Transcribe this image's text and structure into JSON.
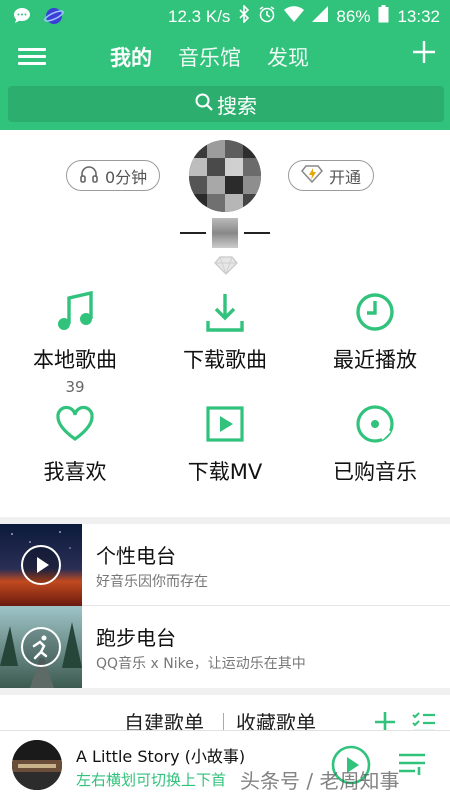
{
  "status_bar": {
    "speed": "12.3 K/s",
    "battery": "86%",
    "time": "13:32"
  },
  "header": {
    "tabs": [
      "我的",
      "音乐馆",
      "发现"
    ],
    "active_tab": "我的",
    "search_label": "搜索"
  },
  "profile": {
    "listen_time": "0分钟",
    "open_vip_label": "开通"
  },
  "grid": {
    "items": [
      {
        "label": "本地歌曲",
        "count": "39",
        "icon": "music-note-icon"
      },
      {
        "label": "下载歌曲",
        "icon": "download-icon"
      },
      {
        "label": "最近播放",
        "icon": "clock-icon"
      },
      {
        "label": "我喜欢",
        "icon": "heart-icon"
      },
      {
        "label": "下载MV",
        "icon": "mv-play-icon"
      },
      {
        "label": "已购音乐",
        "icon": "purchased-disc-icon"
      }
    ]
  },
  "radios": [
    {
      "title": "个性电台",
      "subtitle": "好音乐因你而存在"
    },
    {
      "title": "跑步电台",
      "subtitle": "QQ音乐 x Nike，让运动乐在其中"
    }
  ],
  "playlists": {
    "created_label": "自建歌单",
    "collected_label": "收藏歌单"
  },
  "player": {
    "song_title": "A Little Story (小故事)",
    "hint": "左右横划可切换上下首"
  },
  "watermark": "头条号 / 老周知事",
  "colors": {
    "brand_green": "#31c27c"
  }
}
